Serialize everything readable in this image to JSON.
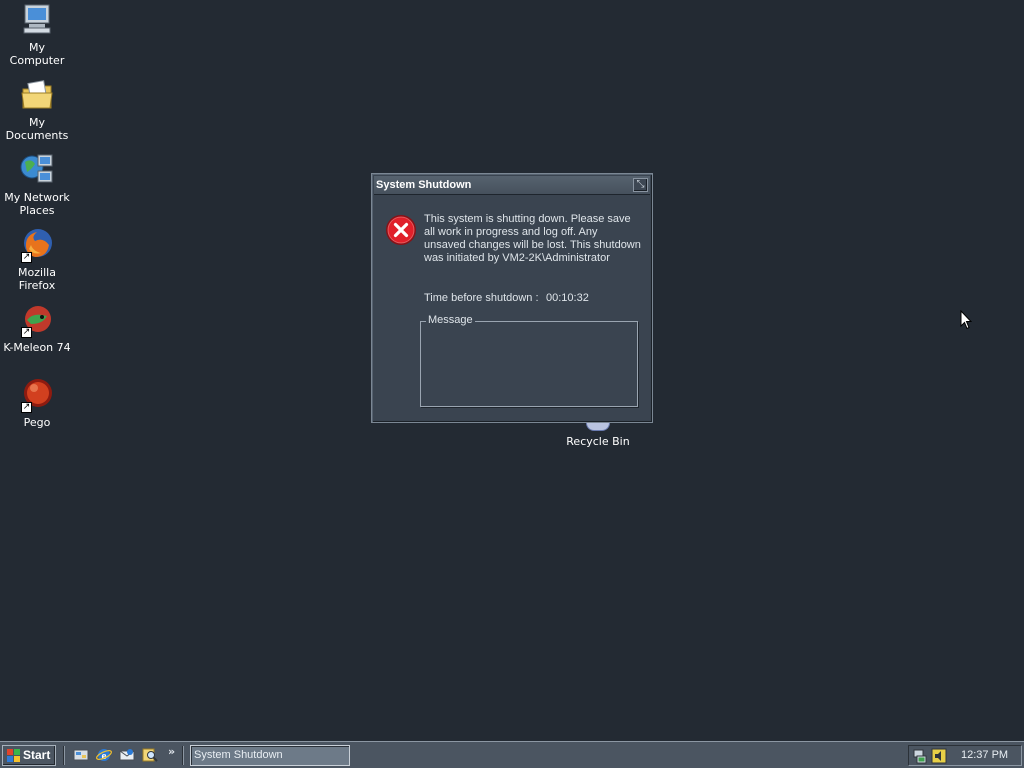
{
  "desktop": {
    "icons": [
      {
        "label": "My Computer",
        "icon": "computer-icon"
      },
      {
        "label": "My Documents",
        "icon": "documents-folder-icon"
      },
      {
        "label": "My Network Places",
        "icon": "network-places-icon"
      },
      {
        "label": "Mozilla Firefox",
        "icon": "firefox-icon"
      },
      {
        "label": "K-Meleon 74",
        "icon": "k-meleon-icon"
      },
      {
        "label": "Pego",
        "icon": "pego-icon"
      }
    ],
    "recycle_bin": {
      "label": "Recycle Bin",
      "icon": "recycle-bin-icon"
    },
    "background_color": "#232a33"
  },
  "dialog": {
    "title": "System Shutdown",
    "close_icon": "close-icon",
    "status_icon": "error-icon",
    "message": "This system is shutting down. Please save all work in progress and log off. Any unsaved changes will be lost. This shutdown was initiated by VM2-2K\\Administrator",
    "time_label": "Time before shutdown :",
    "time_value": "00:10:32",
    "message_group_label": "Message",
    "message_text": ""
  },
  "taskbar": {
    "start_label": "Start",
    "quick_launch": [
      {
        "icon": "show-desktop-icon"
      },
      {
        "icon": "internet-explorer-icon"
      },
      {
        "icon": "outlook-express-icon"
      },
      {
        "icon": "search-icon"
      }
    ],
    "more_label": "»",
    "task_buttons": [
      {
        "label": "System Shutdown",
        "active": true
      }
    ],
    "tray_icons": [
      {
        "icon": "network-icon"
      },
      {
        "icon": "volume-icon"
      }
    ],
    "clock": "12:37 PM"
  },
  "colors": {
    "error_red": "#e0202a",
    "dialog_bg": "#3a4450",
    "taskbar_bg": "#4b5561"
  }
}
